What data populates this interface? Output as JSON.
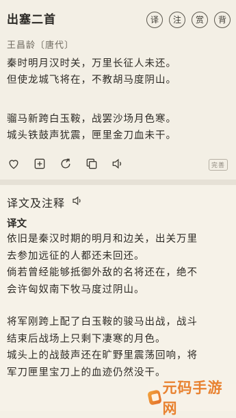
{
  "poem": {
    "title": "出塞二首",
    "actions": [
      {
        "label": "译",
        "name": "translate-button"
      },
      {
        "label": "注",
        "name": "annotate-button"
      },
      {
        "label": "赏",
        "name": "appreciate-button"
      },
      {
        "label": "背",
        "name": "recite-button"
      }
    ],
    "author": "王昌龄〔唐代〕",
    "stanza1": [
      "秦时明月汉时关，万里长征人未还。",
      "但使龙城飞将在，不教胡马度阴山。"
    ],
    "stanza2": [
      "骝马新跨白玉鞍，战罢沙场月色寒。",
      "城头铁鼓声犹震，匣里金刀血未干。"
    ],
    "tools": [
      "heart-icon",
      "add-icon",
      "share-icon",
      "copy-icon",
      "speaker-icon"
    ],
    "badge": "完善"
  },
  "translation": {
    "section_title": "译文及注释",
    "subtitle": "译文",
    "para1": [
      "依旧是秦汉时期的明月和边关，出关万里",
      "去参加远征的人都还未回还。",
      "倘若曾经能够抵御外敌的名将还在，绝不",
      "会许匈奴南下牧马度过阴山。"
    ],
    "para2": [
      "将军刚跨上配了白玉鞍的骏马出战，战斗",
      "结束后战场上只剩下凄寒的月色。",
      "城头上的战鼓声还在旷野里震荡回响，将",
      "军刀匣里宝刀上的血迹仍然没干。"
    ]
  },
  "watermark": {
    "text": "元码手游网"
  }
}
